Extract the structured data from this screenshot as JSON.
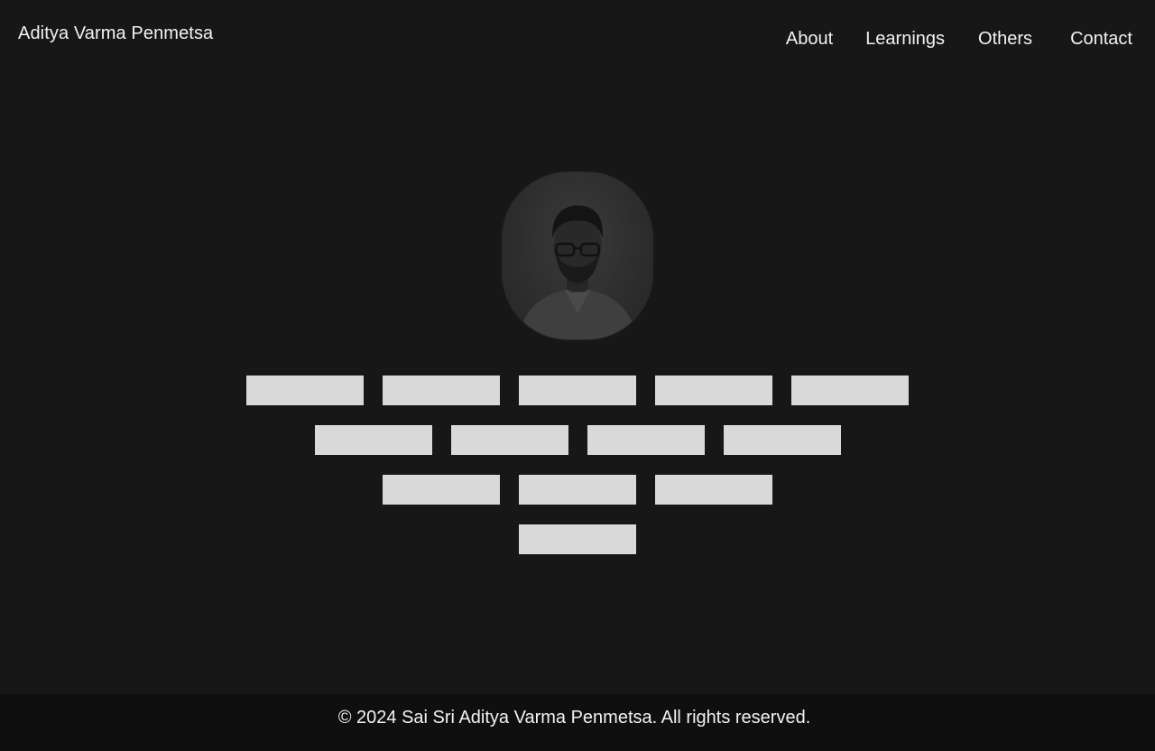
{
  "header": {
    "site_title": "Aditya Varma Penmetsa",
    "nav": [
      {
        "label": "About"
      },
      {
        "label": "Learnings"
      },
      {
        "label": "Others"
      },
      {
        "label": "Contact"
      }
    ]
  },
  "profile": {
    "avatar_icon": "profile-photo"
  },
  "tiles": {
    "rows": [
      5,
      4,
      3,
      1
    ],
    "color": "#d9d9d9"
  },
  "footer": {
    "text": "© 2024 Sai Sri Aditya Varma Penmetsa. All rights reserved."
  },
  "colors": {
    "background": "#171717",
    "footer_background": "#0f0f0f",
    "text": "#f2f2f2"
  }
}
